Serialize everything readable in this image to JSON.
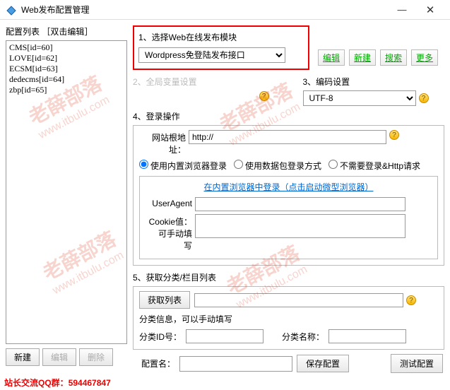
{
  "window": {
    "title": "Web发布配置管理"
  },
  "left": {
    "label": "配置列表 ［双击编辑］",
    "items": [
      "CMS[id=60]",
      "LOVE[id=62]",
      "ECSM[id=63]",
      "dedecms[id=64]",
      "zbp[id=65]"
    ],
    "btn_new": "新建",
    "btn_edit": "编辑",
    "btn_delete": "删除"
  },
  "sec1": {
    "title": "1、选择Web在线发布模块",
    "selected": "Wordpress免登陆发布接口",
    "btn_edit": "编辑",
    "btn_new": "新建",
    "btn_search": "搜索",
    "btn_more": "更多"
  },
  "sec2": {
    "title": "2、全局变量设置"
  },
  "sec3enc": {
    "title": "3、编码设置",
    "value": "UTF-8"
  },
  "sec4": {
    "title": "4、登录操作",
    "root_label": "网站根地址：",
    "root_value": "http://",
    "radio_browser": "使用内置浏览器登录",
    "radio_packet": "使用数据包登录方式",
    "radio_none": "不需要登录&Http请求",
    "inner_link": "在内置浏览器中登录（点击启动微型浏览器）",
    "ua_label": "UserAgent",
    "cookie_label": "Cookie值：\n可手动填\n写"
  },
  "sec5": {
    "title": "5、获取分类/栏目列表",
    "btn_get": "获取列表",
    "info_label": "分类信息，可以手动填写",
    "id_label": "分类ID号：",
    "name_label": "分类名称："
  },
  "bottom": {
    "name_label": "配置名：",
    "btn_save": "保存配置",
    "btn_test": "测试配置"
  },
  "footer": {
    "label": "站长交流QQ群：",
    "qq": "594467847"
  },
  "watermark": {
    "name": "老薛部落",
    "url": "www.itbulu.com"
  }
}
